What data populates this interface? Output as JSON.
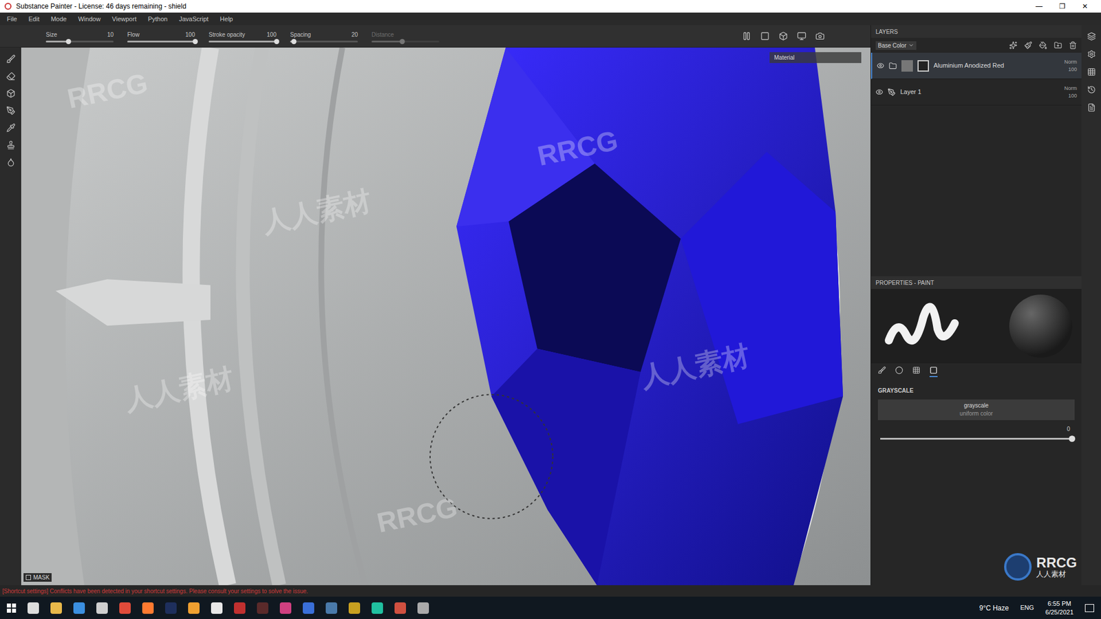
{
  "window": {
    "title": "Substance Painter - License: 46 days remaining - shield",
    "controls": [
      "—",
      "❐",
      "✕"
    ]
  },
  "menu": [
    "File",
    "Edit",
    "Mode",
    "Window",
    "Viewport",
    "Python",
    "JavaScript",
    "Help"
  ],
  "toolbar": {
    "params": [
      {
        "label": "Size",
        "value": "10",
        "level": 0.33,
        "disabled": false
      },
      {
        "label": "Flow",
        "value": "100",
        "level": 1,
        "disabled": false
      },
      {
        "label": "Stroke opacity",
        "value": "100",
        "level": 1,
        "disabled": false
      },
      {
        "label": "Spacing",
        "value": "20",
        "level": 0.05,
        "disabled": false
      },
      {
        "label": "Distance",
        "value": "",
        "level": 0.45,
        "disabled": true
      }
    ]
  },
  "viewport": {
    "dropdown": "Material",
    "mask": "MASK",
    "watermarks": [
      "RRCG",
      "人人素材",
      "RRCG",
      "人人素材",
      "RRCG",
      "人人素材"
    ]
  },
  "layers": {
    "title": "LAYERS",
    "channel": "Base Color",
    "items": [
      {
        "name": "Aluminium Anodized Red",
        "kind": "folder",
        "visible": true,
        "selected": true,
        "blend": "Norm",
        "opacity": "100"
      },
      {
        "name": "Layer 1",
        "kind": "paint",
        "visible": true,
        "selected": false,
        "blend": "Norm",
        "opacity": "100"
      }
    ]
  },
  "properties": {
    "title": "PROPERTIES - PAINT",
    "tabs": [
      {
        "selected": false
      },
      {
        "selected": false
      },
      {
        "selected": false
      },
      {
        "selected": true
      }
    ],
    "section": "GRAYSCALE",
    "button": {
      "label": "grayscale",
      "sub": "uniform color"
    },
    "slider": {
      "reading": "0",
      "level": 1
    }
  },
  "status": "[Shortcut settings] Conflicts have been detected in your shortcut settings. Please consult your settings to solve the issue.",
  "taskbar": {
    "temperature": "9°C",
    "condition": "Haze",
    "lang": "ENG",
    "time": "6:55 PM",
    "date": "6/25/2021"
  },
  "logo": {
    "mark": "RRCG",
    "sub": "人人素材"
  }
}
